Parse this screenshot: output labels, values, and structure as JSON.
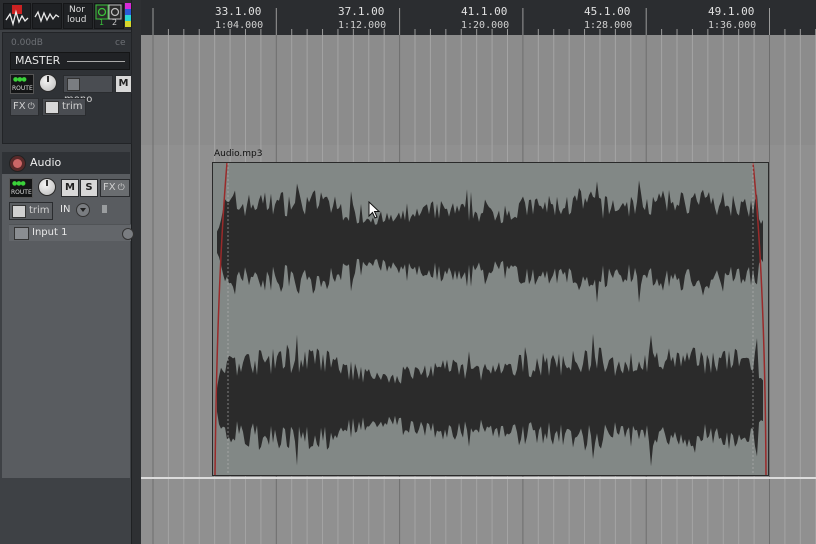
{
  "toolbar": {
    "icons": [
      "metronome-icon",
      "waveform-icon",
      "normalize-loudness-icon",
      "record-mode-icon",
      "color-swatch-icon"
    ],
    "nor_label_1": "Nor",
    "nor_label_2": "loud",
    "indicator_1": "1",
    "indicator_2": "2"
  },
  "master": {
    "volume_db": "0.00dB",
    "pan": "ce",
    "name": "MASTER",
    "route_label": "ROUTE",
    "mono_label": "mono",
    "mute_label": "M",
    "fx_label": "FX",
    "trim_label": "trim"
  },
  "track": {
    "name": "Audio",
    "route_label": "ROUTE",
    "mute_label": "M",
    "solo_label": "S",
    "fx_label": "FX",
    "trim_label": "trim",
    "in_label": "IN",
    "input_label": "Input 1"
  },
  "ruler": {
    "markers": [
      {
        "bar": "33.1.00",
        "time": "1:04.000"
      },
      {
        "bar": "37.1.00",
        "time": "1:12.000"
      },
      {
        "bar": "41.1.00",
        "time": "1:20.000"
      },
      {
        "bar": "45.1.00",
        "time": "1:28.000"
      },
      {
        "bar": "49.1.00",
        "time": "1:36.000"
      }
    ]
  },
  "media_item": {
    "name": "Audio.mp3"
  },
  "colors": {
    "arrange_bg": "#909090",
    "item_bg": "#828886",
    "waveform": "#2b2b2b",
    "fade_line": "#9a2a2a",
    "panel_bg": "#3e4145"
  }
}
